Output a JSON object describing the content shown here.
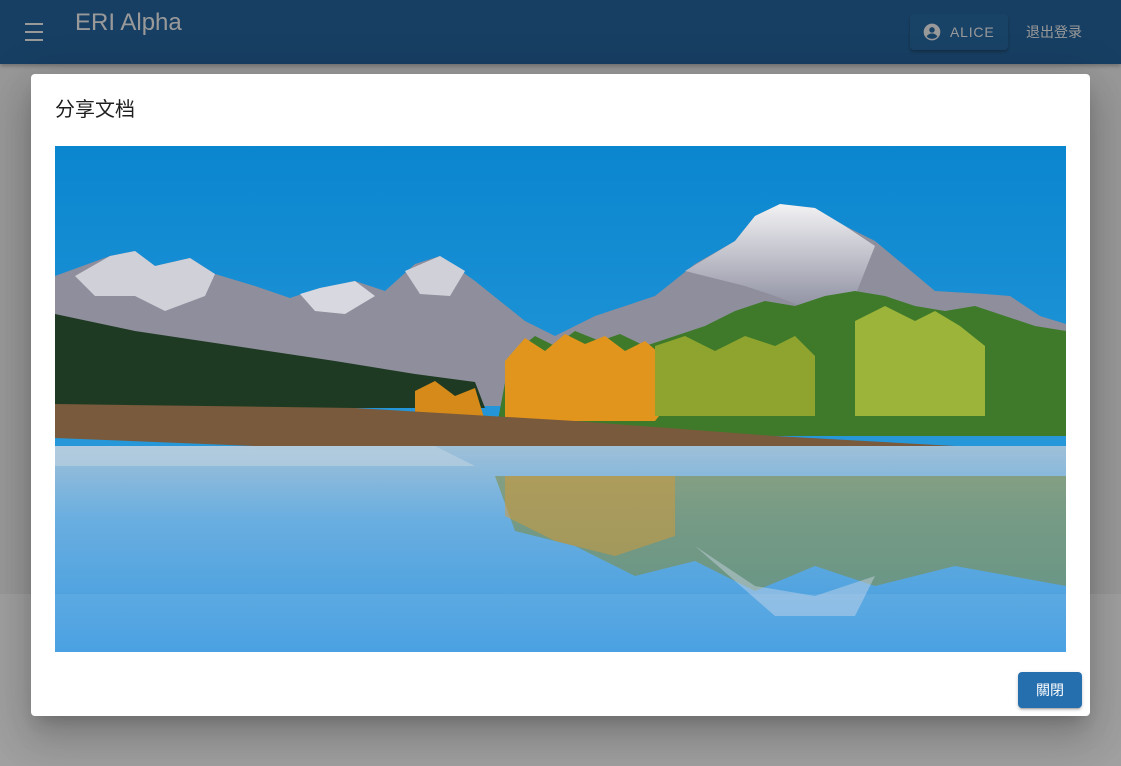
{
  "app": {
    "title": "ERI Alpha",
    "user_label": "ALICE",
    "logout_label": "退出登录",
    "menu_icon": "menu-icon",
    "user_icon": "account-circle-icon"
  },
  "dialog": {
    "title": "分享文档",
    "close_label": "關閉",
    "image_subject": "mountain-lake-autumn-landscape"
  },
  "colors": {
    "app_bar": "#0f5a9c",
    "primary_button": "#1565a8",
    "scrim": "#212121"
  }
}
